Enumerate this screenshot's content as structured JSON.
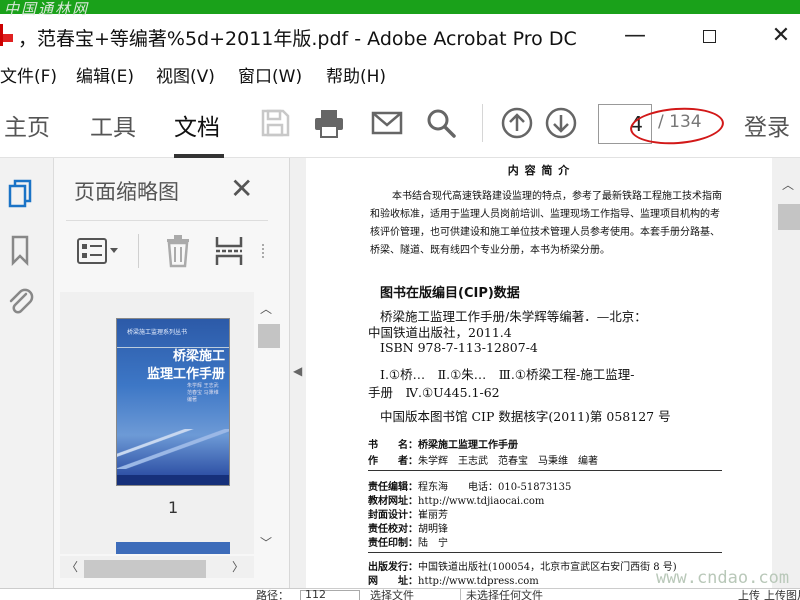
{
  "watermarks": {
    "top_left": "中国通林网",
    "bottom_right": "www.cndao.com"
  },
  "window": {
    "title": "，范春宝+等编著%5d+2011年版.pdf - Adobe Acrobat Pro DC",
    "minimize": "—",
    "close": "✕"
  },
  "menu": {
    "file": "文件(F)",
    "edit": "编辑(E)",
    "view": "视图(V)",
    "window": "窗口(W)",
    "help": "帮助(H)"
  },
  "toolbar": {
    "tab_home": "主页",
    "tab_tools": "工具",
    "tab_document": "文档",
    "page_number": "4",
    "page_total": "/ 134",
    "login": "登录"
  },
  "thumbnails": {
    "title": "页面缩略图",
    "close": "✕",
    "page1_number": "1",
    "cover_series": "桥梁施工监理系列丛书",
    "cover_title_line1": "桥梁施工",
    "cover_title_line2": "监理工作手册",
    "cover_authors": [
      "朱学辉 王志武",
      "范春宝 马秉维",
      "编著"
    ]
  },
  "document": {
    "heading": "内 容 简 介",
    "intro": "本书结合现代高速铁路建设监理的特点，参考了最新铁路工程施工技术指南和验收标准，适用于监理人员岗前培训、监理现场工作指导、监理项目机构的考核评价管理，也可供建设和施工单位技术管理人员参考使用。本套手册分路基、桥梁、隧道、既有线四个专业分册，本书为桥梁分册。",
    "cip_title": "图书在版编目(CIP)数据",
    "cip_line1": "桥梁施工监理工作手册/朱学辉等编著．—北京：",
    "cip_line2": "中国铁道出版社，2011.4",
    "cip_isbn": "ISBN 978-7-113-12807-4",
    "cip_class1": "Ⅰ.①桥…　Ⅱ.①朱…　Ⅲ.①桥梁工程-施工监理-",
    "cip_class2": "手册　Ⅳ.①U445.1-62",
    "cip_number": "中国版本图书馆 CIP 数据核字(2011)第 058127 号",
    "book_label": "书　　名：",
    "book_value": "桥梁施工监理工作手册",
    "author_label": "作　　者：",
    "author_value": "朱学辉　王志武　范春宝　马秉维　编著",
    "editor_label": "责任编辑：",
    "editor_value": "程东海　　电话：010-51873135",
    "web_label": "教材网址：",
    "web_value": "http://www.tdjiaocai.com",
    "cover_label": "封面设计：",
    "cover_value": "崔丽芳",
    "proof_label": "责任校对：",
    "proof_value": "胡明锋",
    "print_label": "责任印制：",
    "print_value": "陆　宁",
    "pub_label": "出版发行：",
    "pub_value": "中国铁道出版社(100054，北京市宣武区右安门西街 8 号)",
    "pubweb_label": "网　　址：",
    "pubweb_value": "http://www.tdpress.com"
  },
  "status": {
    "path_label": "路径：",
    "path_value": "112",
    "select_file": "选择文件",
    "no_file": "未选择任何文件",
    "upload": "上传",
    "upload_tail": "上传图片"
  }
}
